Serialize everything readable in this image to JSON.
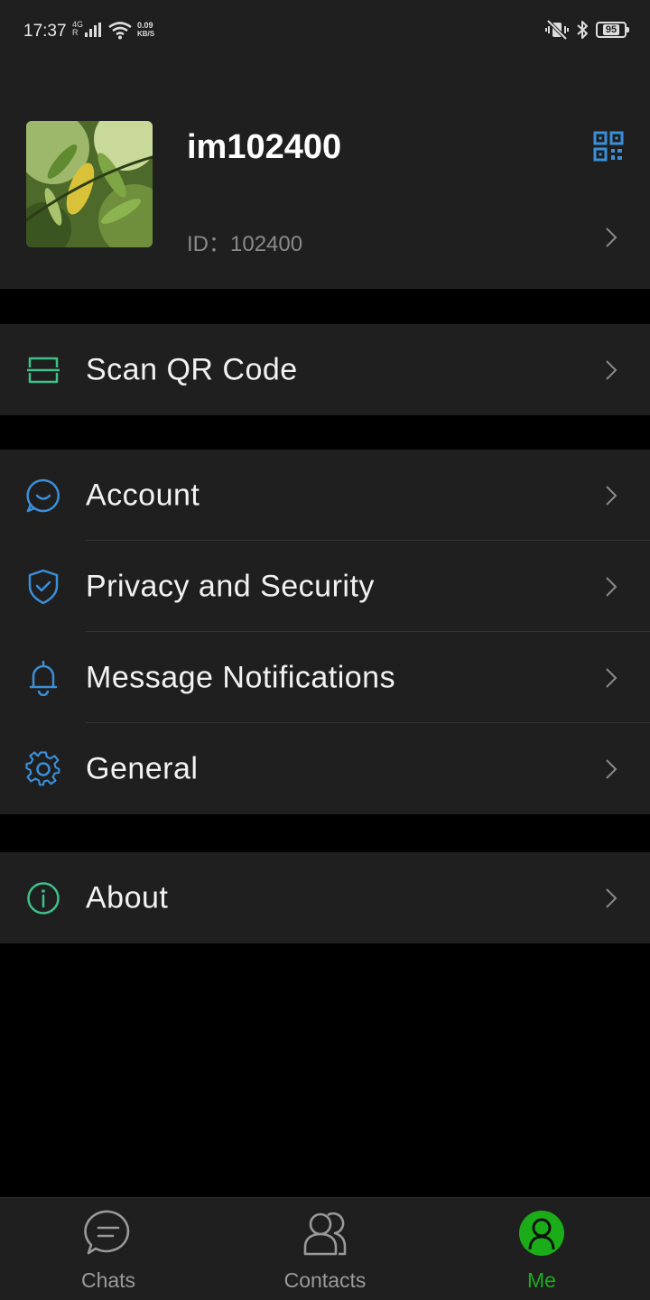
{
  "status_bar": {
    "time": "17:37",
    "network_type": "4G",
    "roaming": "R",
    "speed_value": "0.09",
    "speed_unit": "KB/S",
    "battery": "95"
  },
  "profile": {
    "username": "im102400",
    "id_text": "ID：102400"
  },
  "menu": {
    "scan_qr": "Scan QR Code",
    "account": "Account",
    "privacy": "Privacy and Security",
    "notifications": "Message Notifications",
    "general": "General",
    "about": "About"
  },
  "tabs": [
    {
      "label": "Chats",
      "icon": "chat-bubble-icon"
    },
    {
      "label": "Contacts",
      "icon": "contacts-icon"
    },
    {
      "label": "Me",
      "icon": "person-icon",
      "active": true
    }
  ],
  "colors": {
    "accent_green": "#1aad19",
    "icon_blue": "#3b8fd9",
    "icon_teal": "#3fc28a",
    "background": "#000000",
    "panel": "#1f1f1f"
  }
}
